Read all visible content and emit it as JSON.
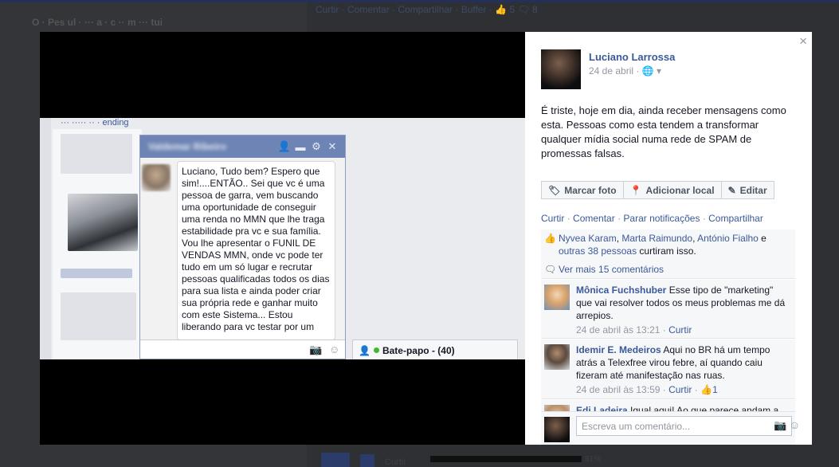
{
  "background": {
    "feed_actions": "Curtir · Comentar · Compartilhar · Buffer · 👍 5 🗨 8",
    "left_card_title": "O · Pes  ul    ·  ···  a · c  ··  m  ···  tui",
    "bottom_text": "Curtir",
    "bottom_progress_label": "51%"
  },
  "photo": {
    "link_text": "··· ····· ·· · ending",
    "chat": {
      "title": "Valdemar Ribeiro",
      "message": "Luciano, Tudo bem? Espero que sim!....ENTÃO.. Sei que vc é uma pessoa de garra, vem buscando uma oportunidade de conseguir uma renda no MMN que lhe traga estabilidade pra vc e sua família. Vou lhe apresentar o FUNIL DE VENDAS MMN, onde vc pode ter tudo em um só lugar e recrutar pessoas qualificadas todos os dias para sua lista e ainda poder  criar sua própria rede e ganhar muito com este Sistema... Estou liberando para vc testar por um",
      "icons": [
        "add-friend-icon",
        "video-icon",
        "gear-icon",
        "close-icon"
      ]
    },
    "batepapo_label": "Bate-papo - (40)"
  },
  "panel": {
    "close_label": "×",
    "author": "Luciano Larrossa",
    "date": "24 de abril",
    "meta_suffix": "· 🌐 ▾",
    "post_text": "É triste, hoje em dia, ainda receber mensagens como esta. Pessoas como esta tendem a transformar qualquer mídia social numa rede de SPAM de promessas falsas.",
    "buttons": {
      "tag": "Marcar foto",
      "location": "Adicionar local",
      "edit": "Editar"
    },
    "actions": {
      "like": "Curtir",
      "comment": "Comentar",
      "notify": "Parar notificações",
      "share": "Compartilhar"
    },
    "likes": {
      "name1": "Nyvea Karam",
      "name2": "Marta Raimundo",
      "name3": "António Fialho",
      "and": " e ",
      "others": "outras 38 pessoas",
      "suffix": " curtiram isso."
    },
    "more_comments": "Ver mais 15 comentários",
    "comments": [
      {
        "name": "Mônica Fuchshuber",
        "text": "Esse tipo de \"marketing\" que vai resolver todos os meus problemas me dá arrepios.",
        "time": "24 de abril às 13:21",
        "action": "Curtir",
        "likes": ""
      },
      {
        "name": "Idemir E. Medeiros",
        "text": "Aqui no BR há um tempo atrás a Telexfree virou febre, aí quando caiu fizeram até manifestação nas ruas.",
        "time": "24 de abril às 13:59",
        "action": "Curtir",
        "likes": "1"
      },
      {
        "name": "Edi Ladeira",
        "text": "Igual aqui! Ao que parece andam a",
        "time": "",
        "action": "",
        "likes": ""
      }
    ],
    "composer_placeholder": "Escreva um comentário..."
  }
}
